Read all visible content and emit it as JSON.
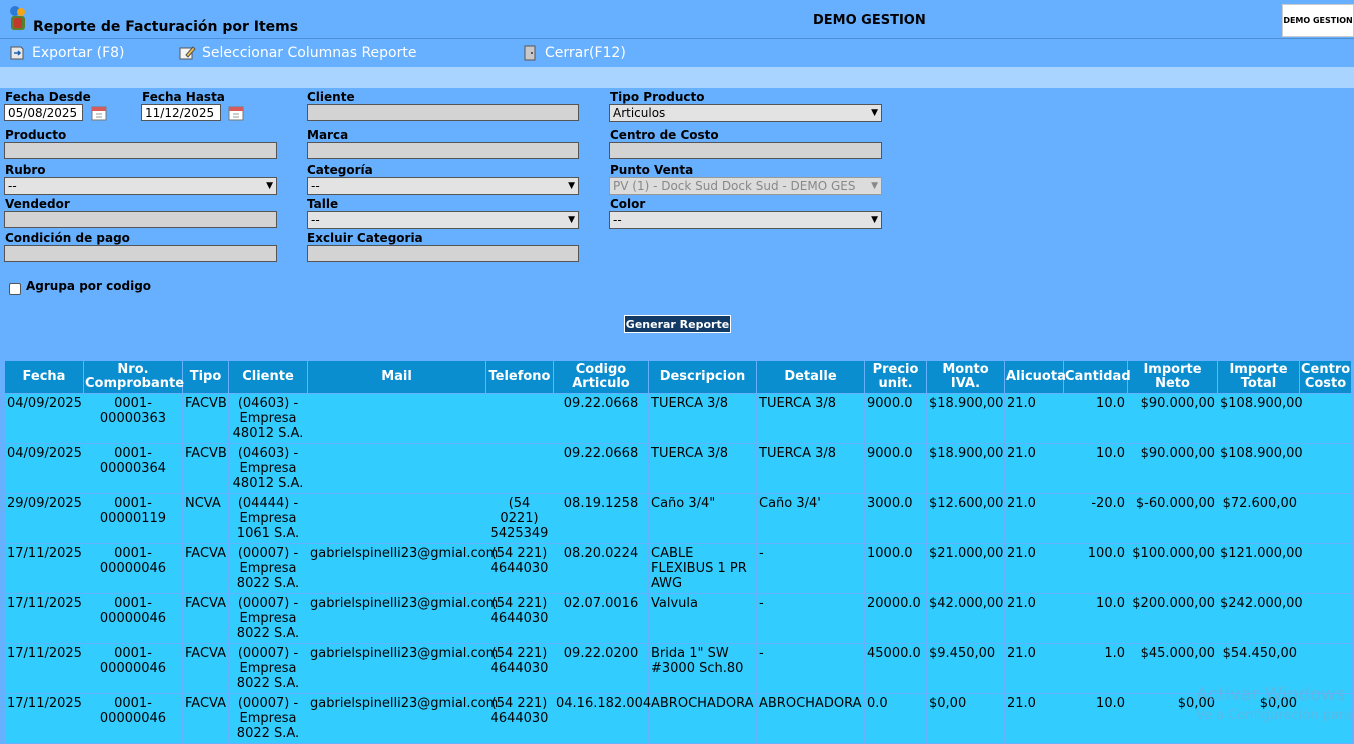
{
  "header": {
    "title": "Reporte de Facturación por Items",
    "center_title": "DEMO GESTION",
    "logo_text": "DEMO GESTION"
  },
  "toolbar": {
    "export": "Exportar (F8)",
    "columns": "Seleccionar Columnas Reporte",
    "close": "Cerrar(F12)"
  },
  "form": {
    "fecha_desde": {
      "label": "Fecha Desde",
      "value": "05/08/2025"
    },
    "fecha_hasta": {
      "label": "Fecha Hasta",
      "value": "11/12/2025"
    },
    "cliente": {
      "label": "Cliente",
      "value": ""
    },
    "tipo_producto": {
      "label": "Tipo Producto",
      "value": "Articulos"
    },
    "producto": {
      "label": "Producto",
      "value": ""
    },
    "marca": {
      "label": "Marca",
      "value": ""
    },
    "centro_costo": {
      "label": "Centro de Costo",
      "value": ""
    },
    "rubro": {
      "label": "Rubro",
      "value": "--"
    },
    "categoria": {
      "label": "Categoría",
      "value": "--"
    },
    "punto_venta": {
      "label": "Punto Venta",
      "value": "PV (1) - Dock Sud Dock Sud - DEMO GES"
    },
    "vendedor": {
      "label": "Vendedor",
      "value": ""
    },
    "talle": {
      "label": "Talle",
      "value": "--"
    },
    "color": {
      "label": "Color",
      "value": "--"
    },
    "condicion_pago": {
      "label": "Condición de pago",
      "value": ""
    },
    "excluir_categoria": {
      "label": "Excluir Categoria",
      "value": ""
    },
    "agrupa_label": "Agrupa por codigo",
    "generate_label": "Generar Reporte"
  },
  "table": {
    "headers": [
      "Fecha",
      "Nro. Comprobante",
      "Tipo",
      "Cliente",
      "Mail",
      "Telefono",
      "Codigo Articulo",
      "Descripcion",
      "Detalle",
      "Precio unit.",
      "Monto IVA.",
      "Alicuota",
      "Cantidad",
      "Importe Neto",
      "Importe Total",
      "Centro Costo"
    ],
    "rows": [
      [
        "04/09/2025",
        "0001-00000363",
        "FACVB",
        "(04603) - Empresa 48012 S.A.",
        "",
        "",
        "09.22.0668",
        "TUERCA 3/8",
        "TUERCA 3/8",
        "9000.0",
        "$18.900,00",
        "21.0",
        "10.0",
        "$90.000,00",
        "$108.900,00",
        ""
      ],
      [
        "04/09/2025",
        "0001-00000364",
        "FACVB",
        "(04603) - Empresa 48012 S.A.",
        "",
        "",
        "09.22.0668",
        "TUERCA 3/8",
        "TUERCA 3/8",
        "9000.0",
        "$18.900,00",
        "21.0",
        "10.0",
        "$90.000,00",
        "$108.900,00",
        ""
      ],
      [
        "29/09/2025",
        "0001-00000119",
        "NCVA",
        "(04444) - Empresa 1061 S.A.",
        "",
        "(54 0221) 5425349",
        "08.19.1258",
        "Caño 3/4\"",
        "Caño 3/4'",
        "3000.0",
        "$12.600,00",
        "21.0",
        "-20.0",
        "$-60.000,00",
        "$72.600,00",
        ""
      ],
      [
        "17/11/2025",
        "0001-00000046",
        "FACVA",
        "(00007) - Empresa 8022 S.A.",
        "gabrielspinelli23@gmial.com",
        "(54 221) 4644030",
        "08.20.0224",
        "CABLE FLEXIBUS 1 PR AWG",
        "-",
        "1000.0",
        "$21.000,00",
        "21.0",
        "100.0",
        "$100.000,00",
        "$121.000,00",
        ""
      ],
      [
        "17/11/2025",
        "0001-00000046",
        "FACVA",
        "(00007) - Empresa 8022 S.A.",
        "gabrielspinelli23@gmial.com",
        "(54 221) 4644030",
        "02.07.0016",
        "Valvula",
        "-",
        "20000.0",
        "$42.000,00",
        "21.0",
        "10.0",
        "$200.000,00",
        "$242.000,00",
        ""
      ],
      [
        "17/11/2025",
        "0001-00000046",
        "FACVA",
        "(00007) - Empresa 8022 S.A.",
        "gabrielspinelli23@gmial.com",
        "(54 221) 4644030",
        "09.22.0200",
        "Brida 1\" SW #3000 Sch.80",
        "-",
        "45000.0",
        "$9.450,00",
        "21.0",
        "1.0",
        "$45.000,00",
        "$54.450,00",
        ""
      ],
      [
        "17/11/2025",
        "0001-00000046",
        "FACVA",
        "(00007) - Empresa 8022 S.A.",
        "gabrielspinelli23@gmial.com",
        "(54 221) 4644030",
        "04.16.182.004",
        "ABROCHADORA",
        "ABROCHADORA",
        "0.0",
        "$0,00",
        "21.0",
        "10.0",
        "$0,00",
        "$0,00",
        ""
      ]
    ]
  },
  "watermark": {
    "line1": "Activar Windows",
    "line2": "Ve a Configuración para"
  }
}
